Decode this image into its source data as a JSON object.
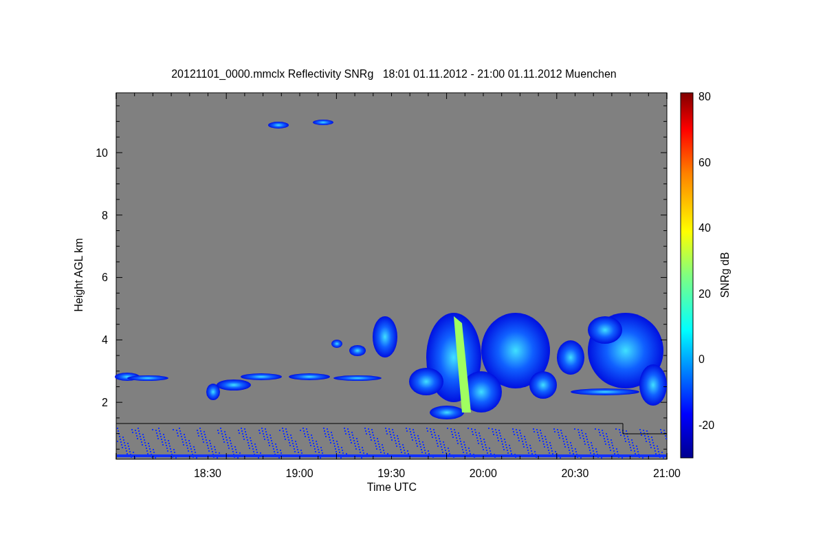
{
  "title": "20121101_0000.mmclx Reflectivity SNRg   18:01 01.11.2012 - 21:00 01.11.2012 Muenchen",
  "y_axis": {
    "label": "Height AGL km",
    "ticks": [
      "10",
      "8",
      "6",
      "4",
      "2"
    ]
  },
  "x_axis": {
    "label": "Time UTC",
    "ticks": [
      "18:30",
      "19:00",
      "19:30",
      "20:00",
      "20:30",
      "21:00"
    ]
  },
  "colorbar": {
    "label": "SNRg dB",
    "ticks": [
      "80",
      "60",
      "40",
      "20",
      "0",
      "-20"
    ]
  }
}
